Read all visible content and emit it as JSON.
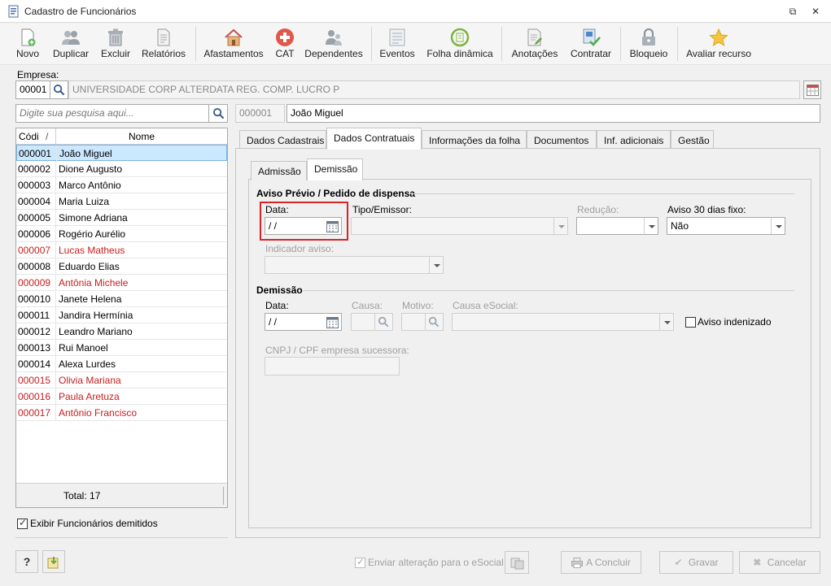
{
  "window": {
    "title": "Cadastro de Funcionários",
    "minimize_label": "⧉",
    "close_label": "✕"
  },
  "toolbar": {
    "items": [
      {
        "label": "Novo",
        "icon": "new-document-icon"
      },
      {
        "label": "Duplicar",
        "icon": "duplicate-users-icon"
      },
      {
        "label": "Excluir",
        "icon": "trash-icon"
      },
      {
        "label": "Relatórios",
        "icon": "report-icon"
      },
      {
        "label": "Afastamentos",
        "icon": "house-icon"
      },
      {
        "label": "CAT",
        "icon": "medical-cross-icon"
      },
      {
        "label": "Dependentes",
        "icon": "dependents-icon"
      },
      {
        "label": "Eventos",
        "icon": "events-list-icon"
      },
      {
        "label": "Folha dinâmica",
        "icon": "dynamic-sheet-icon"
      },
      {
        "label": "Anotações",
        "icon": "notes-icon"
      },
      {
        "label": "Contratar",
        "icon": "hire-icon"
      },
      {
        "label": "Bloqueio",
        "icon": "lock-icon"
      },
      {
        "label": "Avaliar recurso",
        "icon": "star-icon"
      }
    ]
  },
  "empresa": {
    "label": "Empresa:",
    "code": "00001",
    "name": "UNIVERSIDADE CORP ALTERDATA REG. COMP. LUCRO P"
  },
  "search": {
    "placeholder": "Digite sua pesquisa aqui..."
  },
  "employee": {
    "code": "000001",
    "name": "João Miguel"
  },
  "grid": {
    "col_code": "Códi",
    "col_sort": "/",
    "col_name": "Nome",
    "rows": [
      {
        "code": "000001",
        "name": "João Miguel",
        "status": "selected"
      },
      {
        "code": "000002",
        "name": "Dione Augusto",
        "status": "active"
      },
      {
        "code": "000003",
        "name": "Marco Antônio",
        "status": "active"
      },
      {
        "code": "000004",
        "name": "Maria Luiza",
        "status": "active"
      },
      {
        "code": "000005",
        "name": "Simone Adriana",
        "status": "active"
      },
      {
        "code": "000006",
        "name": "Rogério Aurélio",
        "status": "active"
      },
      {
        "code": "000007",
        "name": "Lucas Matheus",
        "status": "dismissed"
      },
      {
        "code": "000008",
        "name": "Eduardo Elias",
        "status": "active"
      },
      {
        "code": "000009",
        "name": "Antônia Michele",
        "status": "dismissed"
      },
      {
        "code": "000010",
        "name": "Janete Helena",
        "status": "active"
      },
      {
        "code": "000011",
        "name": "Jandira Hermínia",
        "status": "active"
      },
      {
        "code": "000012",
        "name": "Leandro Mariano",
        "status": "active"
      },
      {
        "code": "000013",
        "name": "Rui Manoel",
        "status": "active"
      },
      {
        "code": "000014",
        "name": "Alexa Lurdes",
        "status": "active"
      },
      {
        "code": "000015",
        "name": "Olivia Mariana",
        "status": "dismissed"
      },
      {
        "code": "000016",
        "name": "Paula Aretuza",
        "status": "dismissed"
      },
      {
        "code": "000017",
        "name": "Antônio Francisco",
        "status": "dismissed"
      }
    ],
    "total": "Total: 17"
  },
  "show_dismissed": {
    "label": "Exibir Funcionários demitidos",
    "checked": true
  },
  "tabs": [
    "Dados Cadastrais",
    "Dados Contratuais",
    "Informações da folha",
    "Documentos",
    "Inf. adicionais",
    "Gestão"
  ],
  "subtabs": [
    "Admissão",
    "Demissão"
  ],
  "aviso": {
    "section": "Aviso Prévio / Pedido de dispensa",
    "data_label": "Data:",
    "data_value": " /  /",
    "tipo_label": "Tipo/Emissor:",
    "tipo_value": "",
    "reducao_label": "Redução:",
    "reducao_value": "",
    "aviso30_label": "Aviso 30 dias fixo:",
    "aviso30_value": "Não",
    "indicador_label": "Indicador aviso:",
    "indicador_value": ""
  },
  "demissao": {
    "section": "Demissão",
    "data_label": "Data:",
    "data_value": " /  /",
    "causa_label": "Causa:",
    "motivo_label": "Motivo:",
    "causa_esocial_label": "Causa eSocial:",
    "aviso_indenizado_label": "Aviso indenizado",
    "cnpj_label": "CNPJ / CPF empresa sucessora:"
  },
  "footer": {
    "help_label": "?",
    "esocial_label": "Enviar alteração para o eSocial",
    "concluir_label": "A Concluir",
    "gravar_label": "Gravar",
    "cancelar_label": "Cancelar"
  },
  "colors": {
    "accent_red": "#c81e1e",
    "selection": "#cce8ff",
    "highlight_box": "#d9232a"
  }
}
